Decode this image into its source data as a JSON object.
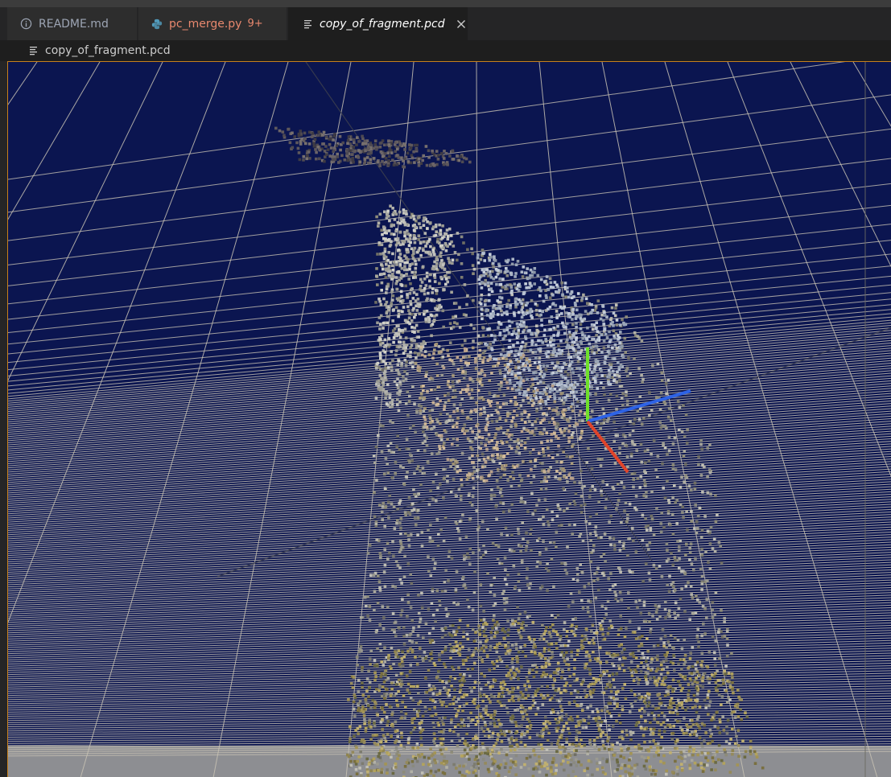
{
  "tabs": [
    {
      "label": "README.md",
      "icon": "info-icon",
      "color": "#9da5b4"
    },
    {
      "label": "pc_merge.py",
      "badge": "9+",
      "icon": "python-icon",
      "color": "#e8886e"
    },
    {
      "label": "copy_of_fragment.pcd",
      "icon": "file-lines-icon",
      "color": "#ffffff",
      "active": true
    }
  ],
  "breadcrumb": {
    "filename": "copy_of_fragment.pcd"
  },
  "viewer": {
    "background_color": "#0b1550",
    "grid_color": "#c8c2b4",
    "floor_color": "#8d8e92",
    "accent_border_color": "#c6801c",
    "axes": [
      {
        "name": "x-axis",
        "color": "#e0442a"
      },
      {
        "name": "y-axis",
        "color": "#6ee02a"
      },
      {
        "name": "z-axis",
        "color": "#2e63e6"
      }
    ]
  }
}
